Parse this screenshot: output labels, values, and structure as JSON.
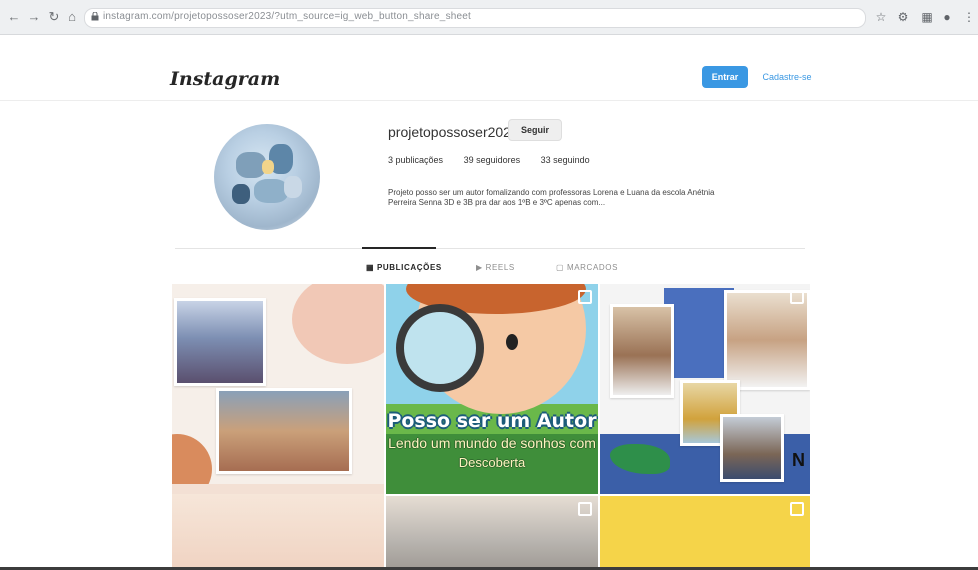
{
  "browser": {
    "url": "instagram.com/projetopossoser2023/?utm_source=ig_web_button_share_sheet",
    "icons": [
      "back-icon",
      "forward-icon",
      "reload-icon",
      "lock-icon",
      "star-icon",
      "extensions-icon",
      "sidebar-icon",
      "profile-icon",
      "menu-icon"
    ]
  },
  "header": {
    "logo": "Instagram",
    "login_label": "Entrar",
    "signup_label": "Cadastre-se"
  },
  "profile": {
    "username": "projetopossoser2023",
    "follow_label": "Seguir",
    "posts": "3 publicações",
    "followers": "39 seguidores",
    "following": "33 seguindo",
    "bio_line1": "Projeto posso ser um autor fomalizando com professoras Lorena e Luana da escola Anétnia",
    "bio_line2": "Perreira Senna 3D e 3B pra dar aos 1ºB e 3ºC apenas com..."
  },
  "tabs": [
    {
      "label": "PUBLICAÇÕES",
      "active": true
    },
    {
      "label": "REELS",
      "active": false
    },
    {
      "label": "MARCADOS",
      "active": false
    }
  ],
  "posts": {
    "post2_title": "Posso ser um Autor",
    "post2_line1": "Lendo um mundo de sonhos com",
    "post2_line2": "Descoberta",
    "post3_letter": "N"
  },
  "colors": {
    "accent": "#3a98e3",
    "text": "#262626",
    "muted": "#8e8e8e"
  }
}
